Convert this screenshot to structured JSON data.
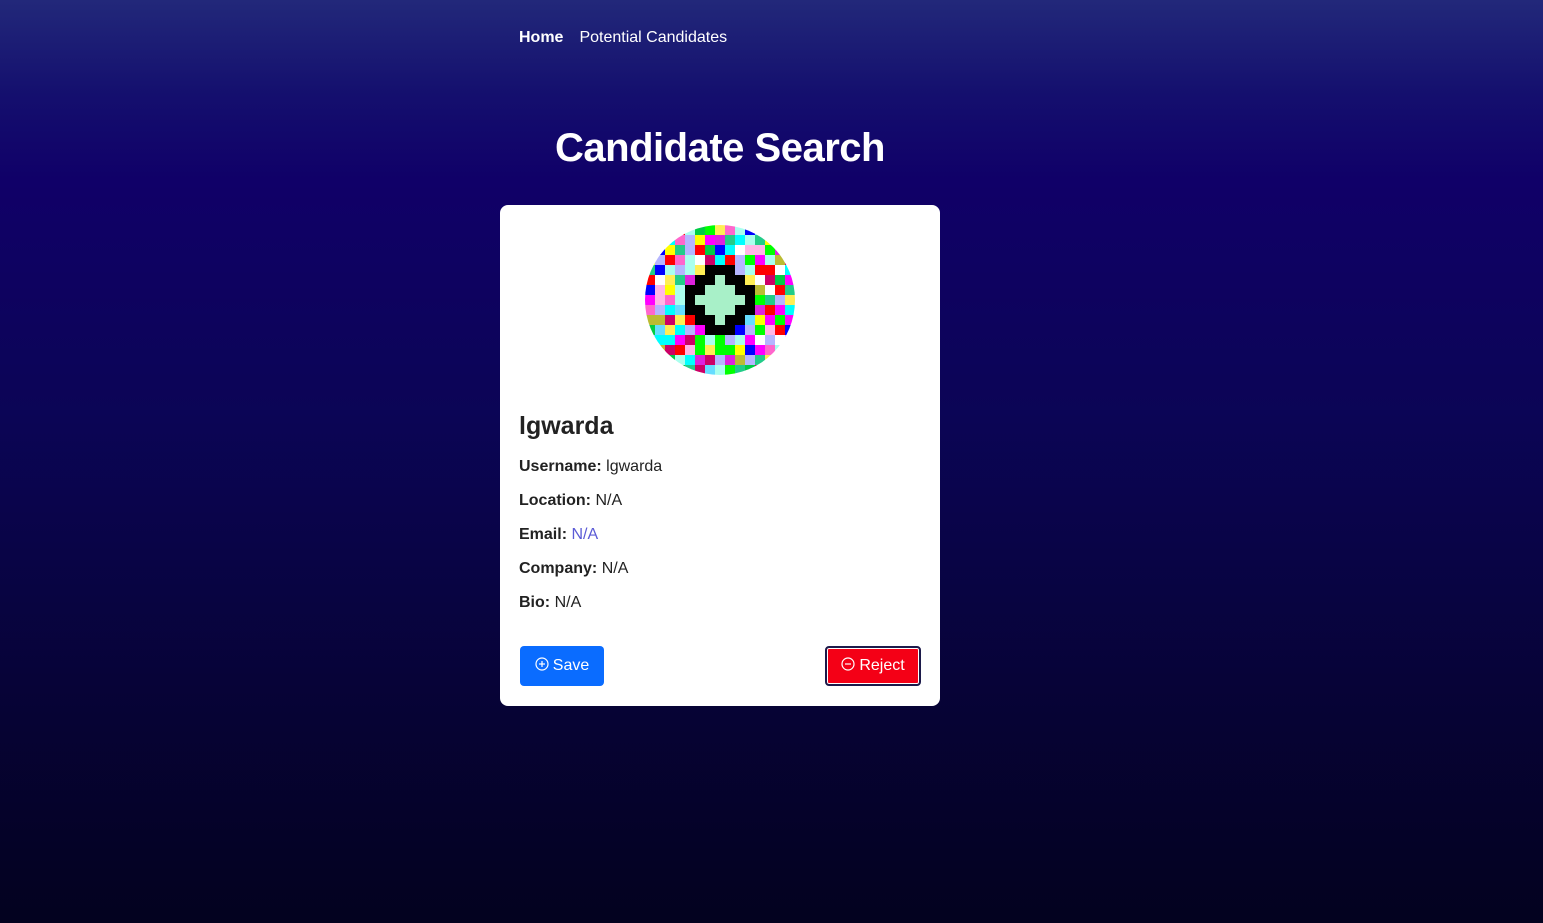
{
  "nav": {
    "items": [
      {
        "label": "Home",
        "active": true
      },
      {
        "label": "Potential Candidates",
        "active": false
      }
    ]
  },
  "page": {
    "title": "Candidate Search"
  },
  "candidate": {
    "name": "lgwarda",
    "fields": [
      {
        "label": "Username:",
        "value": "lgwarda"
      },
      {
        "label": "Location:",
        "value": "N/A"
      },
      {
        "label": "Email:",
        "value": "N/A"
      },
      {
        "label": "Company:",
        "value": "N/A"
      },
      {
        "label": "Bio:",
        "value": "N/A"
      }
    ]
  },
  "actions": {
    "save_label": "Save",
    "save_icon": "plus-circle-icon",
    "reject_label": "Reject",
    "reject_icon": "minus-circle-icon"
  },
  "colors": {
    "save": "#0a6cff",
    "reject": "#f40016",
    "link": "#5b5bd6",
    "background_top": "#22287a",
    "background_bottom": "#03021f"
  }
}
